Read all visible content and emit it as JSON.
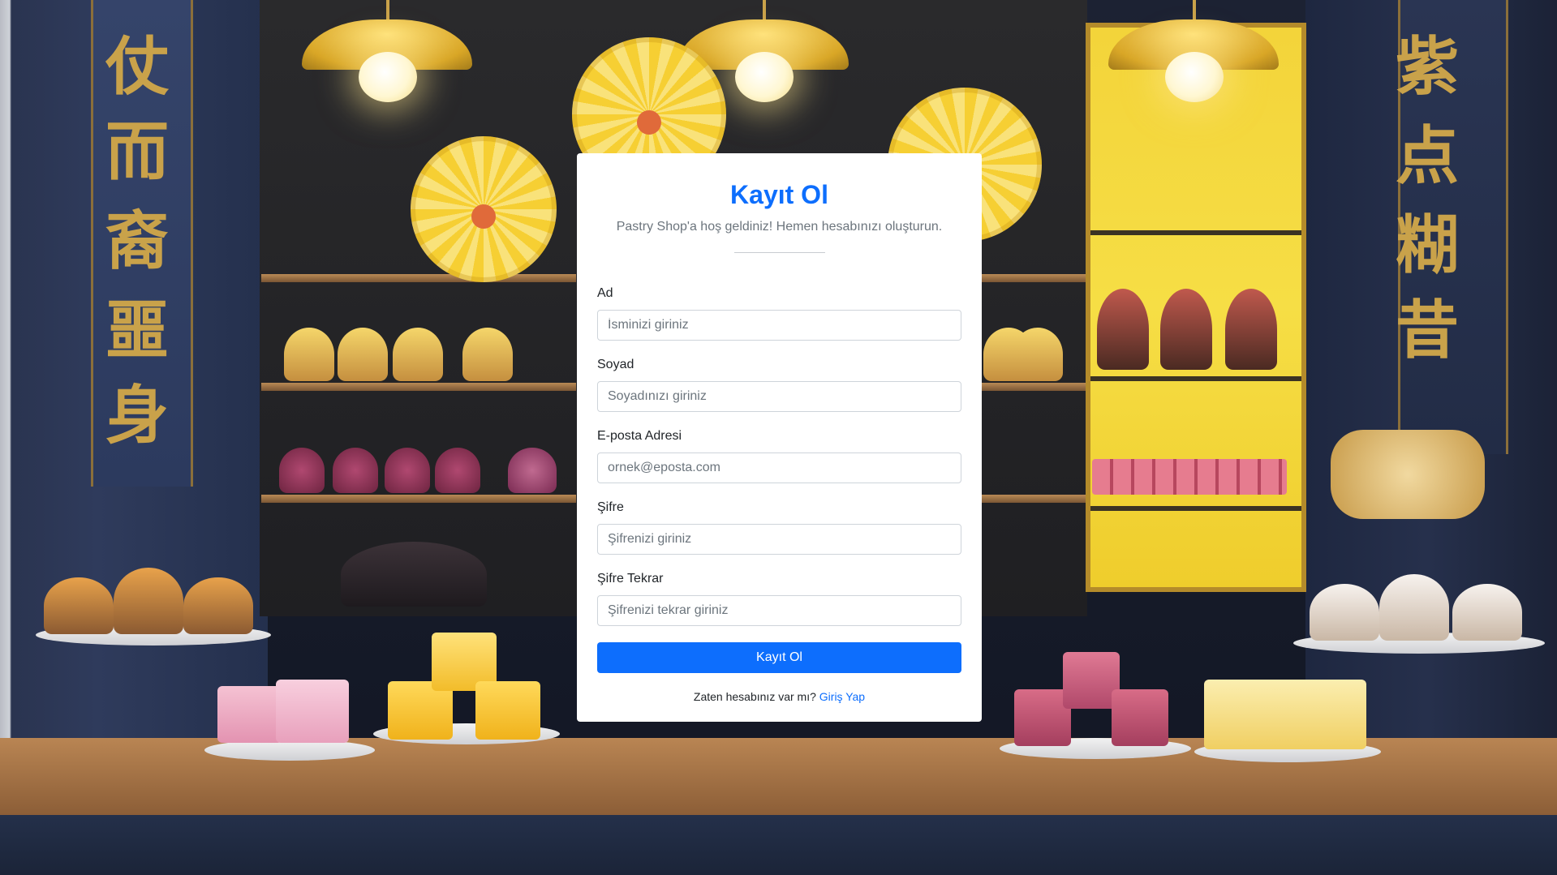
{
  "card": {
    "title": "Kayıt Ol",
    "subtitle": "Pastry Shop'a hoş geldiniz! Hemen hesabınızı oluşturun."
  },
  "form": {
    "first_name": {
      "label": "Ad",
      "placeholder": "İsminizi giriniz",
      "value": ""
    },
    "last_name": {
      "label": "Soyad",
      "placeholder": "Soyadınızı giriniz",
      "value": ""
    },
    "email": {
      "label": "E-posta Adresi",
      "placeholder": "ornek@eposta.com",
      "value": ""
    },
    "password": {
      "label": "Şifre",
      "placeholder": "Şifrenizi giriniz",
      "value": ""
    },
    "password_confirm": {
      "label": "Şifre Tekrar",
      "placeholder": "Şifrenizi tekrar giriniz",
      "value": ""
    },
    "submit_label": "Kayıt Ol"
  },
  "footer": {
    "prompt": "Zaten hesabınız var mı?",
    "login_link": "Giriş Yap"
  },
  "colors": {
    "accent": "#0d6efd",
    "muted_text": "#6c757d",
    "card_background": "#ffffff"
  },
  "background": {
    "description_icon": "pastry-shop-background-image"
  }
}
